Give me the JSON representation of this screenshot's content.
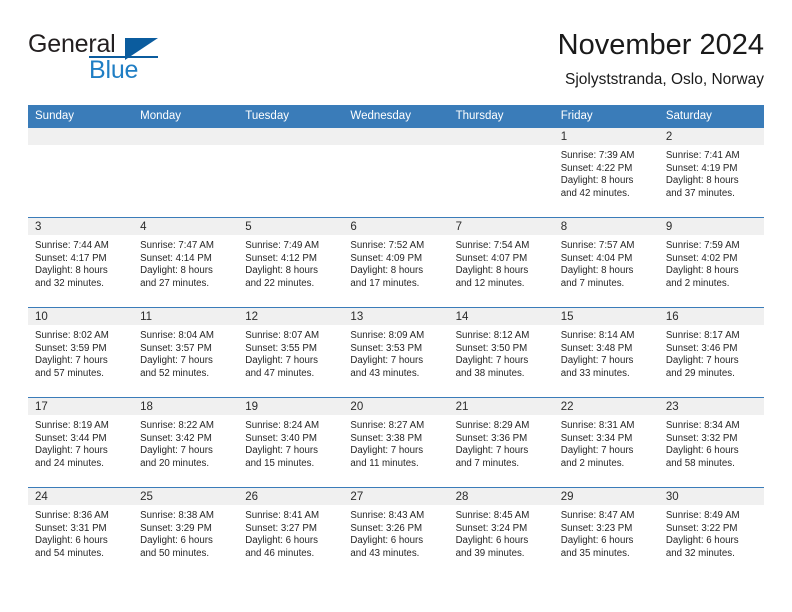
{
  "brand": {
    "name_part1": "General",
    "name_part2": "Blue",
    "accent_color": "#1f7ec4",
    "logo_icon": "triangle-flag-icon"
  },
  "header": {
    "title": "November 2024",
    "subtitle": "Sjolyststranda, Oslo, Norway"
  },
  "calendar": {
    "header_color": "#3a7cb9",
    "weekdays": [
      "Sunday",
      "Monday",
      "Tuesday",
      "Wednesday",
      "Thursday",
      "Friday",
      "Saturday"
    ],
    "weeks": [
      [
        {
          "day": "",
          "lines": []
        },
        {
          "day": "",
          "lines": []
        },
        {
          "day": "",
          "lines": []
        },
        {
          "day": "",
          "lines": []
        },
        {
          "day": "",
          "lines": []
        },
        {
          "day": "1",
          "lines": [
            "Sunrise: 7:39 AM",
            "Sunset: 4:22 PM",
            "Daylight: 8 hours",
            "and 42 minutes."
          ]
        },
        {
          "day": "2",
          "lines": [
            "Sunrise: 7:41 AM",
            "Sunset: 4:19 PM",
            "Daylight: 8 hours",
            "and 37 minutes."
          ]
        }
      ],
      [
        {
          "day": "3",
          "lines": [
            "Sunrise: 7:44 AM",
            "Sunset: 4:17 PM",
            "Daylight: 8 hours",
            "and 32 minutes."
          ]
        },
        {
          "day": "4",
          "lines": [
            "Sunrise: 7:47 AM",
            "Sunset: 4:14 PM",
            "Daylight: 8 hours",
            "and 27 minutes."
          ]
        },
        {
          "day": "5",
          "lines": [
            "Sunrise: 7:49 AM",
            "Sunset: 4:12 PM",
            "Daylight: 8 hours",
            "and 22 minutes."
          ]
        },
        {
          "day": "6",
          "lines": [
            "Sunrise: 7:52 AM",
            "Sunset: 4:09 PM",
            "Daylight: 8 hours",
            "and 17 minutes."
          ]
        },
        {
          "day": "7",
          "lines": [
            "Sunrise: 7:54 AM",
            "Sunset: 4:07 PM",
            "Daylight: 8 hours",
            "and 12 minutes."
          ]
        },
        {
          "day": "8",
          "lines": [
            "Sunrise: 7:57 AM",
            "Sunset: 4:04 PM",
            "Daylight: 8 hours",
            "and 7 minutes."
          ]
        },
        {
          "day": "9",
          "lines": [
            "Sunrise: 7:59 AM",
            "Sunset: 4:02 PM",
            "Daylight: 8 hours",
            "and 2 minutes."
          ]
        }
      ],
      [
        {
          "day": "10",
          "lines": [
            "Sunrise: 8:02 AM",
            "Sunset: 3:59 PM",
            "Daylight: 7 hours",
            "and 57 minutes."
          ]
        },
        {
          "day": "11",
          "lines": [
            "Sunrise: 8:04 AM",
            "Sunset: 3:57 PM",
            "Daylight: 7 hours",
            "and 52 minutes."
          ]
        },
        {
          "day": "12",
          "lines": [
            "Sunrise: 8:07 AM",
            "Sunset: 3:55 PM",
            "Daylight: 7 hours",
            "and 47 minutes."
          ]
        },
        {
          "day": "13",
          "lines": [
            "Sunrise: 8:09 AM",
            "Sunset: 3:53 PM",
            "Daylight: 7 hours",
            "and 43 minutes."
          ]
        },
        {
          "day": "14",
          "lines": [
            "Sunrise: 8:12 AM",
            "Sunset: 3:50 PM",
            "Daylight: 7 hours",
            "and 38 minutes."
          ]
        },
        {
          "day": "15",
          "lines": [
            "Sunrise: 8:14 AM",
            "Sunset: 3:48 PM",
            "Daylight: 7 hours",
            "and 33 minutes."
          ]
        },
        {
          "day": "16",
          "lines": [
            "Sunrise: 8:17 AM",
            "Sunset: 3:46 PM",
            "Daylight: 7 hours",
            "and 29 minutes."
          ]
        }
      ],
      [
        {
          "day": "17",
          "lines": [
            "Sunrise: 8:19 AM",
            "Sunset: 3:44 PM",
            "Daylight: 7 hours",
            "and 24 minutes."
          ]
        },
        {
          "day": "18",
          "lines": [
            "Sunrise: 8:22 AM",
            "Sunset: 3:42 PM",
            "Daylight: 7 hours",
            "and 20 minutes."
          ]
        },
        {
          "day": "19",
          "lines": [
            "Sunrise: 8:24 AM",
            "Sunset: 3:40 PM",
            "Daylight: 7 hours",
            "and 15 minutes."
          ]
        },
        {
          "day": "20",
          "lines": [
            "Sunrise: 8:27 AM",
            "Sunset: 3:38 PM",
            "Daylight: 7 hours",
            "and 11 minutes."
          ]
        },
        {
          "day": "21",
          "lines": [
            "Sunrise: 8:29 AM",
            "Sunset: 3:36 PM",
            "Daylight: 7 hours",
            "and 7 minutes."
          ]
        },
        {
          "day": "22",
          "lines": [
            "Sunrise: 8:31 AM",
            "Sunset: 3:34 PM",
            "Daylight: 7 hours",
            "and 2 minutes."
          ]
        },
        {
          "day": "23",
          "lines": [
            "Sunrise: 8:34 AM",
            "Sunset: 3:32 PM",
            "Daylight: 6 hours",
            "and 58 minutes."
          ]
        }
      ],
      [
        {
          "day": "24",
          "lines": [
            "Sunrise: 8:36 AM",
            "Sunset: 3:31 PM",
            "Daylight: 6 hours",
            "and 54 minutes."
          ]
        },
        {
          "day": "25",
          "lines": [
            "Sunrise: 8:38 AM",
            "Sunset: 3:29 PM",
            "Daylight: 6 hours",
            "and 50 minutes."
          ]
        },
        {
          "day": "26",
          "lines": [
            "Sunrise: 8:41 AM",
            "Sunset: 3:27 PM",
            "Daylight: 6 hours",
            "and 46 minutes."
          ]
        },
        {
          "day": "27",
          "lines": [
            "Sunrise: 8:43 AM",
            "Sunset: 3:26 PM",
            "Daylight: 6 hours",
            "and 43 minutes."
          ]
        },
        {
          "day": "28",
          "lines": [
            "Sunrise: 8:45 AM",
            "Sunset: 3:24 PM",
            "Daylight: 6 hours",
            "and 39 minutes."
          ]
        },
        {
          "day": "29",
          "lines": [
            "Sunrise: 8:47 AM",
            "Sunset: 3:23 PM",
            "Daylight: 6 hours",
            "and 35 minutes."
          ]
        },
        {
          "day": "30",
          "lines": [
            "Sunrise: 8:49 AM",
            "Sunset: 3:22 PM",
            "Daylight: 6 hours",
            "and 32 minutes."
          ]
        }
      ]
    ]
  }
}
